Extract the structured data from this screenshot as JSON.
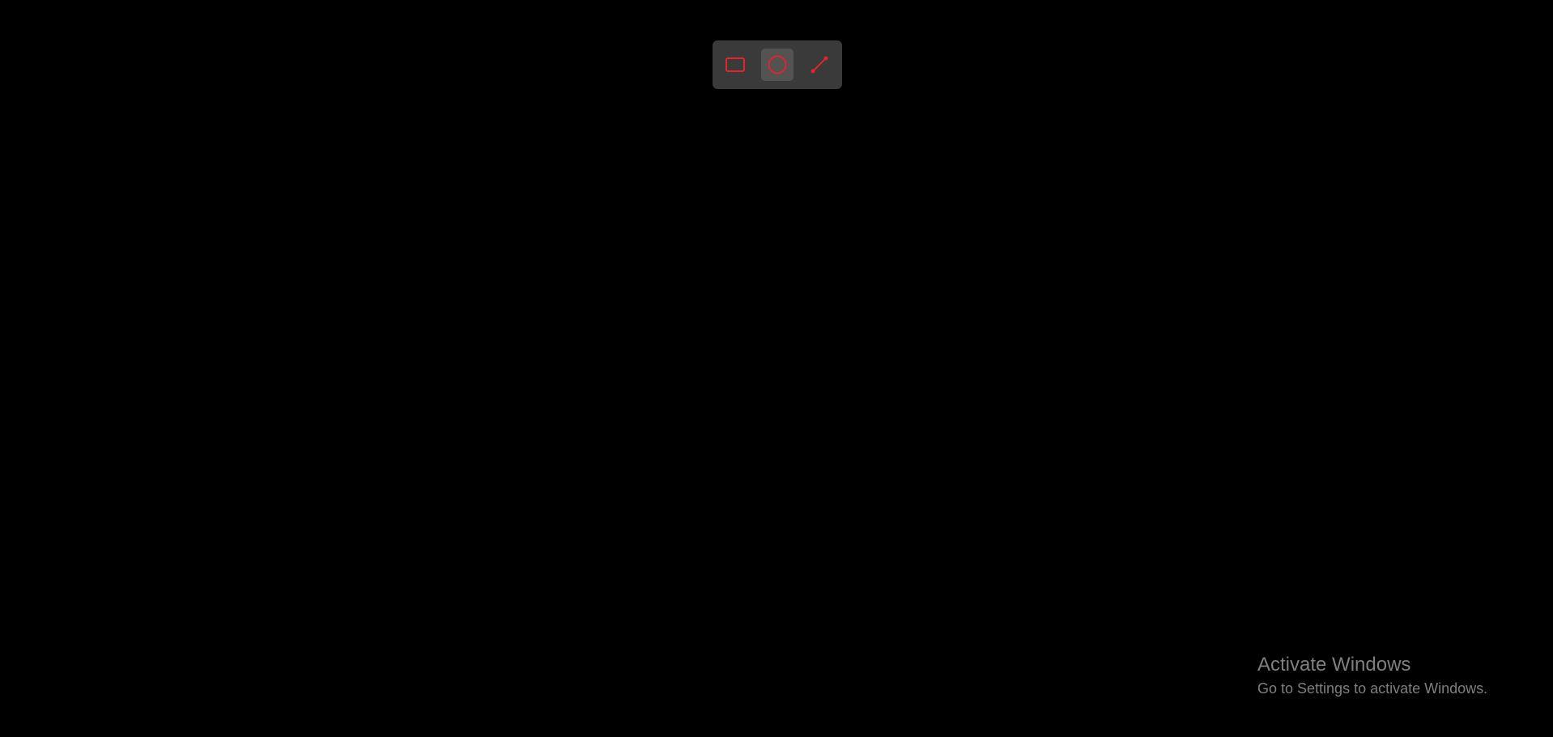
{
  "colors": {
    "background": "#000000",
    "toolbar_bg": "#3a3a3a",
    "selected_bg": "#535353",
    "tool_icon": "#e0262b",
    "watermark_text": "#7f7f7f"
  },
  "toolbar": {
    "tools": [
      {
        "name": "rectangle",
        "icon": "rectangle-icon",
        "selected": false
      },
      {
        "name": "ellipse",
        "icon": "circle-icon",
        "selected": true
      },
      {
        "name": "line",
        "icon": "line-icon",
        "selected": false
      }
    ]
  },
  "watermark": {
    "title": "Activate Windows",
    "subtitle": "Go to Settings to activate Windows."
  }
}
